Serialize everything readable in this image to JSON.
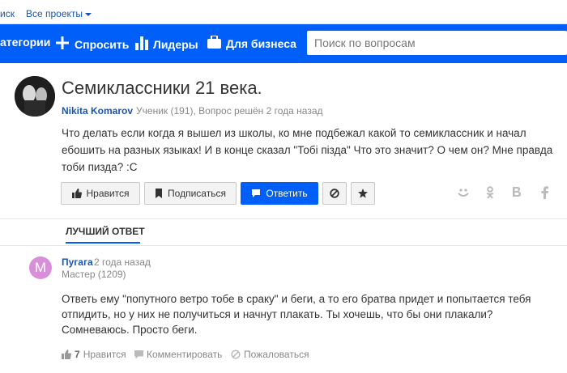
{
  "topbar": {
    "search_partial": "иск",
    "all_projects": "Все проекты"
  },
  "nav": {
    "categories": "атегории",
    "ask": "Спросить",
    "leaders": "Лидеры",
    "business": "Для бизнеса",
    "search_placeholder": "Поиск по вопросам",
    "bg_color": "#005ff9"
  },
  "question": {
    "title": "Семиклассники 21 века.",
    "author": "Nikita Komarov",
    "meta": "Ученик (191), Вопрос решён 2 года назад",
    "text": "Что делать если когда я вышел из школы, ко мне подбежал какой то семиклассник и начал ебошить на разных языках! И в конце сказал \"Тобі пізда\" Что это значит? О чем он? Мне правда тоби пизда? :С"
  },
  "actions": {
    "like": "Нравится",
    "subscribe": "Подписаться",
    "answer": "Ответить"
  },
  "share_icons": [
    "moimir-icon",
    "odnoklassniki-icon",
    "vk-icon",
    "facebook-icon"
  ],
  "best_answer_tab": "ЛУЧШИЙ ОТВЕТ",
  "answer": {
    "avatar_letter": "М",
    "avatar_color": "#d98ed9",
    "author": "Пугага",
    "date": "2 года назад",
    "rank": "Мастер (1209)",
    "text": "Ответь ему \"попутного ветро тобе в сраку\" и беги, а то его братва придет и попытается тебя отпидить, но у них не получиться и начнут плакать. Ты хочешь, что бы они плакали? Сомневаюсь. Просто беги.",
    "likes": "7",
    "like_label": "Нравится",
    "comment_label": "Комментировать",
    "report_label": "Пожаловаться"
  }
}
